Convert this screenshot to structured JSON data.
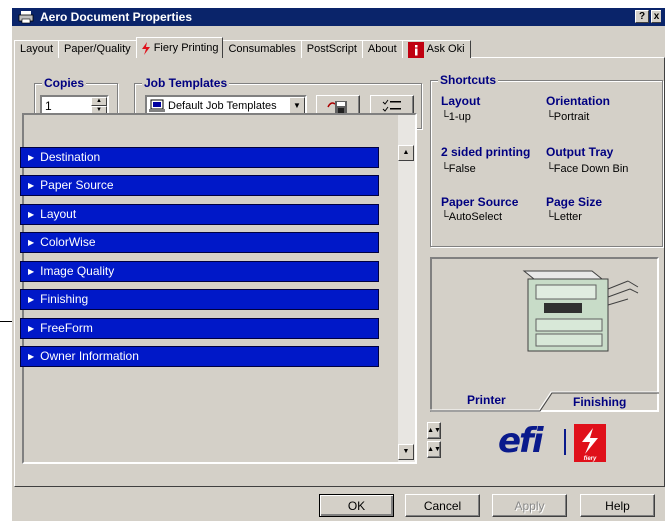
{
  "window": {
    "title": "Aero Document Properties",
    "help_btn": "?",
    "close_btn": "x"
  },
  "tabs": [
    {
      "label": "Layout",
      "active": false,
      "icon": ""
    },
    {
      "label": "Paper/Quality",
      "active": false,
      "icon": ""
    },
    {
      "label": "Fiery Printing",
      "active": true,
      "icon": "fiery-icon"
    },
    {
      "label": "Consumables",
      "active": false,
      "icon": ""
    },
    {
      "label": "PostScript",
      "active": false,
      "icon": ""
    },
    {
      "label": "About",
      "active": false,
      "icon": ""
    },
    {
      "label": "Ask Oki",
      "active": false,
      "icon": "info-icon"
    }
  ],
  "copies": {
    "legend": "Copies",
    "value": "1"
  },
  "job_templates": {
    "legend": "Job Templates",
    "selected": "Default Job Templates"
  },
  "sections": [
    "Destination",
    "Paper Source",
    "Layout",
    "ColorWise",
    "Image Quality",
    "Finishing",
    "FreeForm",
    "Owner Information"
  ],
  "shortcuts": {
    "legend": "Shortcuts",
    "items": [
      {
        "label": "Layout",
        "value": "1-up"
      },
      {
        "label": "Orientation",
        "value": "Portrait"
      },
      {
        "label": "2 sided printing",
        "value": "False"
      },
      {
        "label": "Output Tray",
        "value": "Face Down Bin"
      },
      {
        "label": "Paper Source",
        "value": "AutoSelect"
      },
      {
        "label": "Page Size",
        "value": "Letter"
      }
    ]
  },
  "printer_tabs": {
    "printer": "Printer",
    "finishing": "Finishing"
  },
  "logo": {
    "efi": "efi",
    "fiery": "fiery"
  },
  "footer": {
    "ok": "OK",
    "cancel": "Cancel",
    "apply": "Apply",
    "help": "Help"
  },
  "colors": {
    "section_bg": "#0018c8",
    "title_bg": "#0a246a",
    "heading": "#000080",
    "dialog_bg": "#d4d0c8"
  }
}
